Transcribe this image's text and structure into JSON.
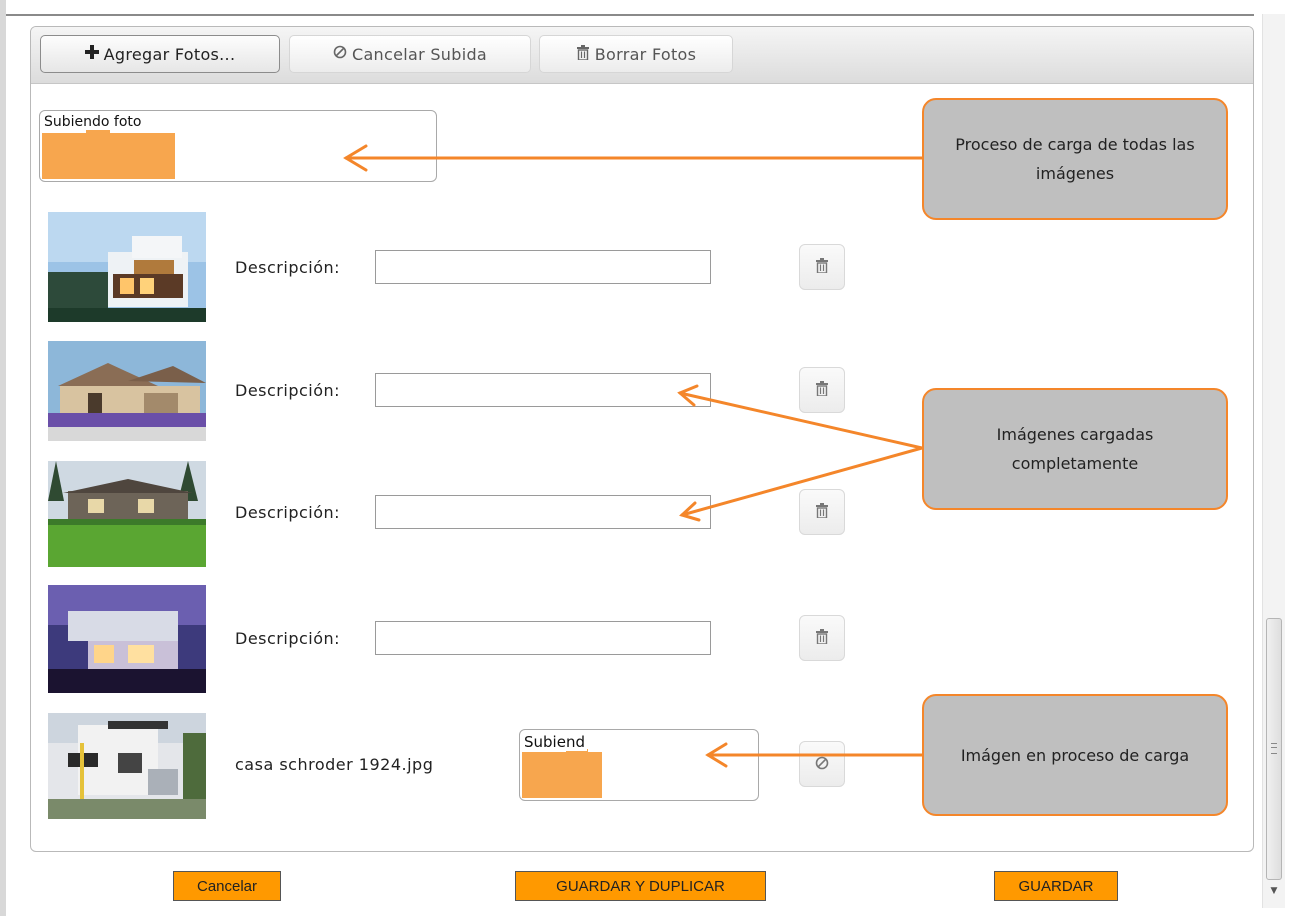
{
  "toolbar": {
    "add_photos": "Agregar Fotos...",
    "cancel_upload": "Cancelar Subida",
    "delete_photos": "Borrar Fotos"
  },
  "overall_progress": {
    "label": "Subiendo foto",
    "fraction": 0.34
  },
  "photos": [
    {
      "label": "Descripción:",
      "value": "",
      "status": "loaded"
    },
    {
      "label": "Descripción:",
      "value": "",
      "status": "loaded"
    },
    {
      "label": "Descripción:",
      "value": "",
      "status": "loaded"
    },
    {
      "label": "Descripción:",
      "value": "",
      "status": "loaded"
    }
  ],
  "uploading_file": {
    "name": "casa schroder 1924.jpg",
    "progress_label": "Subiend",
    "fraction": 0.34
  },
  "callouts": {
    "overall": "Proceso de carga de todas las imágenes",
    "loaded": "Imágenes cargadas completamente",
    "in_progress": "Imágen en proceso de carga"
  },
  "footer": {
    "cancel": "Cancelar",
    "save_duplicate": "GUARDAR Y DUPLICAR",
    "save": "GUARDAR"
  },
  "colors": {
    "accent": "#f4862a",
    "progress": "#f7a64e",
    "footer_button": "#ff9900",
    "callout_bg": "#bfbfbf"
  },
  "icons": {
    "add": "plus-icon",
    "cancel": "ban-icon",
    "delete": "trash-icon"
  }
}
